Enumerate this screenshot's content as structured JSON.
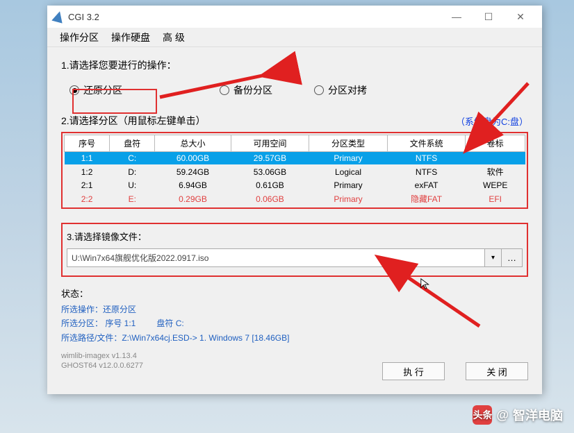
{
  "window": {
    "title": "CGI 3.2"
  },
  "menu": {
    "item1": "操作分区",
    "item2": "操作硬盘",
    "item3": "高 级"
  },
  "step1": {
    "label": "1.请选择您要进行的操作：",
    "opt1": "还原分区",
    "opt2": "备份分区",
    "opt3": "分区对拷"
  },
  "step2": {
    "label": "2.请选择分区（用鼠标左键单击）",
    "note": "（系统盘为C:盘）",
    "headers": {
      "h1": "序号",
      "h2": "盘符",
      "h3": "总大小",
      "h4": "可用空间",
      "h5": "分区类型",
      "h6": "文件系统",
      "h7": "卷标"
    },
    "rows": [
      {
        "n": "1:1",
        "d": "C:",
        "t": "60.00GB",
        "f": "29.57GB",
        "p": "Primary",
        "fs": "NTFS",
        "v": ""
      },
      {
        "n": "1:2",
        "d": "D:",
        "t": "59.24GB",
        "f": "53.06GB",
        "p": "Logical",
        "fs": "NTFS",
        "v": "软件"
      },
      {
        "n": "2:1",
        "d": "U:",
        "t": "6.94GB",
        "f": "0.61GB",
        "p": "Primary",
        "fs": "exFAT",
        "v": "WEPE"
      },
      {
        "n": "2:2",
        "d": "E:",
        "t": "0.29GB",
        "f": "0.06GB",
        "p": "Primary",
        "fs": "隐藏FAT",
        "v": "EFI"
      }
    ]
  },
  "step3": {
    "label": "3.请选择镜像文件：",
    "path": "U:\\Win7x64旗舰优化版2022.0917.iso"
  },
  "status": {
    "title": "状态：",
    "line1a": "所选操作：还原分区",
    "line2a": "所选分区：  序号 1:1",
    "line2b": "盘符 C:",
    "line3": "所选路径/文件：Z:\\Win7x64cj.ESD-> 1. Windows 7  [18.46GB]"
  },
  "version": {
    "l1": "wimlib-imagex v1.13.4",
    "l2": "GHOST64 v12.0.0.6277"
  },
  "buttons": {
    "run": "执 行",
    "close": "关 闭"
  },
  "watermark": {
    "at": "@",
    "text": "智洋电脑",
    "icon": "头条"
  }
}
